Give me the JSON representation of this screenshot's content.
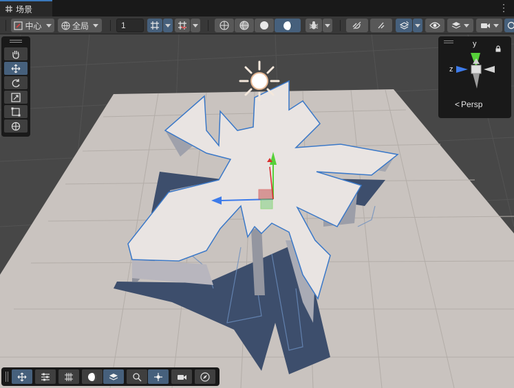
{
  "tab": {
    "label": "场景",
    "icon": "grid-icon"
  },
  "toolbar": {
    "pivot_label": "中心",
    "space_label": "全局",
    "snap_value": "1",
    "view_mode": "Persp"
  },
  "gizmo": {
    "y_label": "y",
    "z_label": "z",
    "persp_label": "Persp"
  },
  "colors": {
    "accent": "#46607c",
    "selection_outline": "#3a78c8",
    "gizmo_y": "#56d139",
    "gizmo_z": "#3d7bea",
    "gizmo_x": "#d93030"
  }
}
